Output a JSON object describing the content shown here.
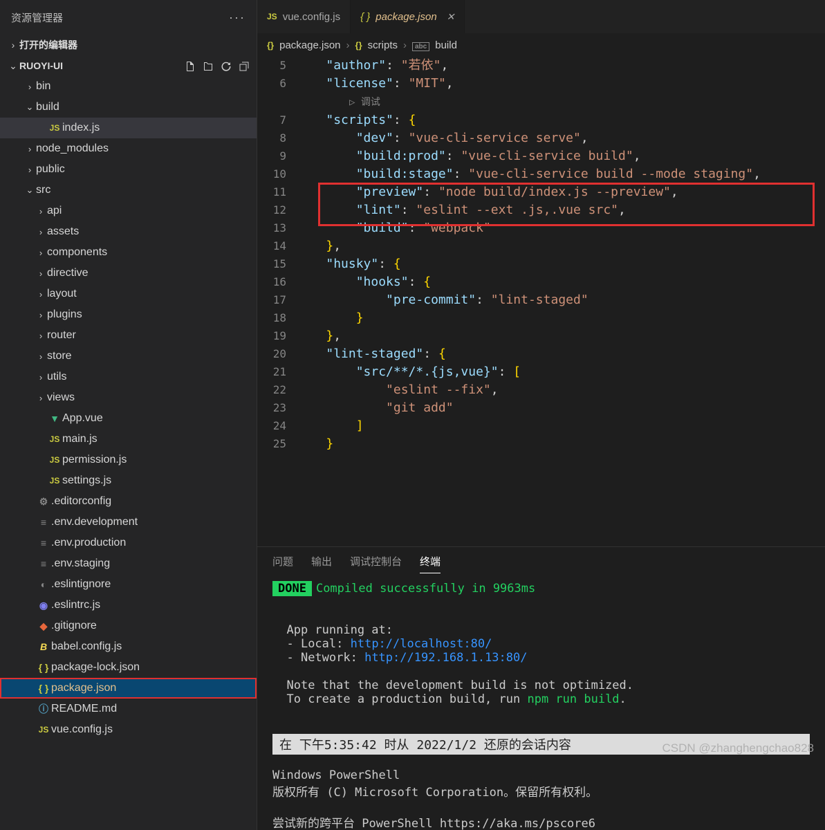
{
  "sidebar": {
    "title": "资源管理器",
    "sections": {
      "openEditors": "打开的编辑器",
      "project": "RUOYI-UI"
    },
    "tree": [
      {
        "type": "folder",
        "name": "bin",
        "depth": 1,
        "open": false
      },
      {
        "type": "folder",
        "name": "build",
        "depth": 1,
        "open": true
      },
      {
        "type": "file",
        "name": "index.js",
        "depth": 2,
        "icon": "js",
        "highlight": true
      },
      {
        "type": "folder",
        "name": "node_modules",
        "depth": 1,
        "open": false
      },
      {
        "type": "folder",
        "name": "public",
        "depth": 1,
        "open": false
      },
      {
        "type": "folder",
        "name": "src",
        "depth": 1,
        "open": true
      },
      {
        "type": "folder",
        "name": "api",
        "depth": 2,
        "open": false
      },
      {
        "type": "folder",
        "name": "assets",
        "depth": 2,
        "open": false
      },
      {
        "type": "folder",
        "name": "components",
        "depth": 2,
        "open": false
      },
      {
        "type": "folder",
        "name": "directive",
        "depth": 2,
        "open": false
      },
      {
        "type": "folder",
        "name": "layout",
        "depth": 2,
        "open": false
      },
      {
        "type": "folder",
        "name": "plugins",
        "depth": 2,
        "open": false
      },
      {
        "type": "folder",
        "name": "router",
        "depth": 2,
        "open": false
      },
      {
        "type": "folder",
        "name": "store",
        "depth": 2,
        "open": false
      },
      {
        "type": "folder",
        "name": "utils",
        "depth": 2,
        "open": false
      },
      {
        "type": "folder",
        "name": "views",
        "depth": 2,
        "open": false
      },
      {
        "type": "file",
        "name": "App.vue",
        "depth": 2,
        "icon": "vue"
      },
      {
        "type": "file",
        "name": "main.js",
        "depth": 2,
        "icon": "js"
      },
      {
        "type": "file",
        "name": "permission.js",
        "depth": 2,
        "icon": "js"
      },
      {
        "type": "file",
        "name": "settings.js",
        "depth": 2,
        "icon": "js"
      },
      {
        "type": "file",
        "name": ".editorconfig",
        "depth": 1,
        "icon": "gear"
      },
      {
        "type": "file",
        "name": ".env.development",
        "depth": 1,
        "icon": "txt"
      },
      {
        "type": "file",
        "name": ".env.production",
        "depth": 1,
        "icon": "txt"
      },
      {
        "type": "file",
        "name": ".env.staging",
        "depth": 1,
        "icon": "txt"
      },
      {
        "type": "file",
        "name": ".eslintignore",
        "depth": 1,
        "icon": "eslint"
      },
      {
        "type": "file",
        "name": ".eslintrc.js",
        "depth": 1,
        "icon": "eslint2"
      },
      {
        "type": "file",
        "name": ".gitignore",
        "depth": 1,
        "icon": "git"
      },
      {
        "type": "file",
        "name": "babel.config.js",
        "depth": 1,
        "icon": "babel"
      },
      {
        "type": "file",
        "name": "package-lock.json",
        "depth": 1,
        "icon": "json"
      },
      {
        "type": "file",
        "name": "package.json",
        "depth": 1,
        "icon": "json",
        "selected": true,
        "redbox": true
      },
      {
        "type": "file",
        "name": "README.md",
        "depth": 1,
        "icon": "md"
      },
      {
        "type": "file",
        "name": "vue.config.js",
        "depth": 1,
        "icon": "js"
      }
    ]
  },
  "tabs": [
    {
      "icon": "js",
      "label": "vue.config.js",
      "active": false
    },
    {
      "icon": "json",
      "label": "package.json",
      "active": true,
      "modified": true
    }
  ],
  "breadcrumb": [
    {
      "icon": "{}",
      "label": "package.json"
    },
    {
      "icon": "{}",
      "label": "scripts"
    },
    {
      "icon": "abc",
      "label": "build"
    }
  ],
  "debugLens": "▷ 调试",
  "code_lines": [
    {
      "n": 5,
      "html": "    <span class='s-key'>\"author\"</span><span class='s-pun'>:</span> <span class='s-str'>\"若依\"</span><span class='s-pun'>,</span>"
    },
    {
      "n": 6,
      "html": "    <span class='s-key'>\"license\"</span><span class='s-pun'>:</span> <span class='s-str'>\"MIT\"</span><span class='s-pun'>,</span>"
    },
    {
      "n": 0,
      "html": "      <span class='debug-lens'>▷ 调试</span>"
    },
    {
      "n": 7,
      "html": "    <span class='s-key'>\"scripts\"</span><span class='s-pun'>:</span> <span class='s-br'>{</span>"
    },
    {
      "n": 8,
      "html": "        <span class='s-key'>\"dev\"</span><span class='s-pun'>:</span> <span class='s-str'>\"vue-cli-service serve\"</span><span class='s-pun'>,</span>"
    },
    {
      "n": 9,
      "html": "        <span class='s-key'>\"build:prod\"</span><span class='s-pun'>:</span> <span class='s-str'>\"vue-cli-service build\"</span><span class='s-pun'>,</span>"
    },
    {
      "n": 10,
      "html": "        <span class='s-key'>\"build:stage\"</span><span class='s-pun'>:</span> <span class='s-str'>\"vue-cli-service build --mode staging\"</span><span class='s-pun'>,</span>"
    },
    {
      "n": 11,
      "html": "        <span class='s-key'>\"preview\"</span><span class='s-pun'>:</span> <span class='s-str'>\"node build/index.js --preview\"</span><span class='s-pun'>,</span>"
    },
    {
      "n": 12,
      "html": "        <span class='s-key'>\"lint\"</span><span class='s-pun'>:</span> <span class='s-str'>\"eslint --ext .js,.vue src\"</span><span class='s-pun'>,</span>"
    },
    {
      "n": 13,
      "html": "        <span class='s-key'>\"build\"</span><span class='s-pun'>:</span> <span class='s-str'>\"webpack\"</span>"
    },
    {
      "n": 14,
      "html": "    <span class='s-br'>}</span><span class='s-pun'>,</span>"
    },
    {
      "n": 15,
      "html": "    <span class='s-key'>\"husky\"</span><span class='s-pun'>:</span> <span class='s-br'>{</span>"
    },
    {
      "n": 16,
      "html": "        <span class='s-key'>\"hooks\"</span><span class='s-pun'>:</span> <span class='s-br'>{</span>"
    },
    {
      "n": 17,
      "html": "            <span class='s-key'>\"pre-commit\"</span><span class='s-pun'>:</span> <span class='s-str'>\"lint-staged\"</span>"
    },
    {
      "n": 18,
      "html": "        <span class='s-br'>}</span>"
    },
    {
      "n": 19,
      "html": "    <span class='s-br'>}</span><span class='s-pun'>,</span>"
    },
    {
      "n": 20,
      "html": "    <span class='s-key'>\"lint-staged\"</span><span class='s-pun'>:</span> <span class='s-br'>{</span>"
    },
    {
      "n": 21,
      "html": "        <span class='s-key'>\"src/**/*.{js,vue}\"</span><span class='s-pun'>:</span> <span class='s-br'>[</span>"
    },
    {
      "n": 22,
      "html": "            <span class='s-str'>\"eslint --fix\"</span><span class='s-pun'>,</span>"
    },
    {
      "n": 23,
      "html": "            <span class='s-str'>\"git add\"</span>"
    },
    {
      "n": 24,
      "html": "        <span class='s-br'>]</span>"
    },
    {
      "n": 25,
      "html": "    <span class='s-br'>}</span>"
    }
  ],
  "panel": {
    "tabs": [
      "问题",
      "输出",
      "调试控制台",
      "终端"
    ],
    "activeTab": 3,
    "doneLabel": "DONE",
    "doneMsg": "Compiled successfully in 9963ms",
    "appRunning": "App running at:",
    "localLabel": "- Local:   ",
    "localUrl": "http://localhost:",
    "localPort": "80",
    "localSlash": "/",
    "netLabel": "- Network: ",
    "netUrl": "http://192.168.1.13:",
    "netPort": "80",
    "netSlash": "/",
    "note1": "Note that the development build is not optimized.",
    "note2a": "To create a production build, run ",
    "note2b": "npm run build",
    "note2c": ".",
    "restoreBar": "在 下午5:35:42 时从 2022/1/2 还原的会话内容",
    "ps1": "Windows PowerShell",
    "ps2": "版权所有 (C) Microsoft Corporation。保留所有权利。",
    "ps3a": "尝试新的跨平台 ",
    "ps3b": "PowerShell https://aka.ms/pscore6"
  },
  "watermark": "CSDN @zhanghengchao828"
}
